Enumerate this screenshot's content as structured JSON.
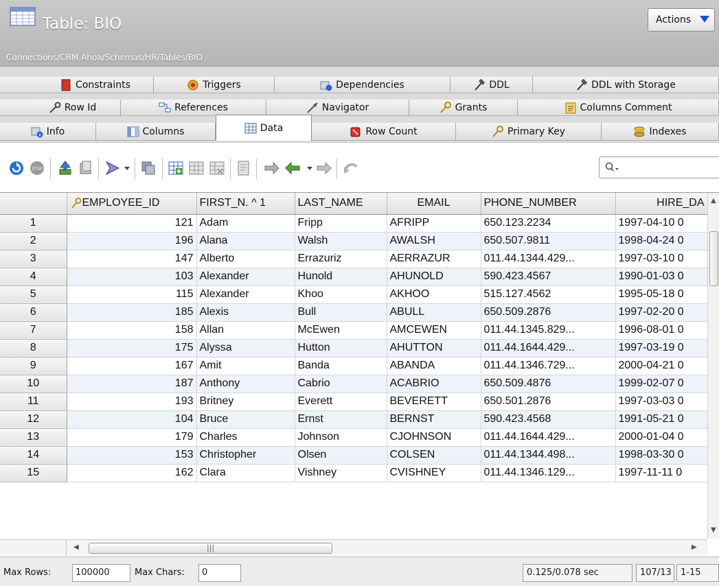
{
  "header": {
    "title": "Table: BIO",
    "path": "Connections/CRM Ahoa/Schemas/HR/Tables/BIO",
    "actions_label": "Actions"
  },
  "tabs": {
    "row1": [
      {
        "label": "Constraints",
        "icon": "constraints-icon"
      },
      {
        "label": "Triggers",
        "icon": "triggers-icon"
      },
      {
        "label": "Dependencies",
        "icon": "dependencies-icon"
      },
      {
        "label": "DDL",
        "icon": "hammer-icon"
      },
      {
        "label": "DDL with Storage",
        "icon": "hammer-icon"
      }
    ],
    "row2": [
      {
        "label": "Row Id",
        "icon": "key-icon"
      },
      {
        "label": "References",
        "icon": "references-icon"
      },
      {
        "label": "Navigator",
        "icon": "navigator-icon"
      },
      {
        "label": "Grants",
        "icon": "key-icon"
      },
      {
        "label": "Columns Comment",
        "icon": "comment-icon"
      }
    ],
    "row3": [
      {
        "label": "Info",
        "icon": "info-icon"
      },
      {
        "label": "Columns",
        "icon": "columns-icon"
      },
      {
        "label": "Data",
        "icon": "grid-icon",
        "selected": true
      },
      {
        "label": "Row Count",
        "icon": "dice-icon"
      },
      {
        "label": "Primary Key",
        "icon": "key-icon"
      },
      {
        "label": "Indexes",
        "icon": "index-icon"
      }
    ]
  },
  "grid": {
    "columns": [
      "",
      "EMPLOYEE_ID",
      "FIRST_N. ^ 1",
      "LAST_NAME",
      "EMAIL",
      "PHONE_NUMBER",
      "HIRE_DA"
    ],
    "rows": [
      [
        "1",
        "121",
        "Adam",
        "Fripp",
        "AFRIPP",
        "650.123.2234",
        "1997-04-10 0"
      ],
      [
        "2",
        "196",
        "Alana",
        "Walsh",
        "AWALSH",
        "650.507.9811",
        "1998-04-24 0"
      ],
      [
        "3",
        "147",
        "Alberto",
        "Errazuriz",
        "AERRAZUR",
        "011.44.1344.429...",
        "1997-03-10 0"
      ],
      [
        "4",
        "103",
        "Alexander",
        "Hunold",
        "AHUNOLD",
        "590.423.4567",
        "1990-01-03 0"
      ],
      [
        "5",
        "115",
        "Alexander",
        "Khoo",
        "AKHOO",
        "515.127.4562",
        "1995-05-18 0"
      ],
      [
        "6",
        "185",
        "Alexis",
        "Bull",
        "ABULL",
        "650.509.2876",
        "1997-02-20 0"
      ],
      [
        "7",
        "158",
        "Allan",
        "McEwen",
        "AMCEWEN",
        "011.44.1345.829...",
        "1996-08-01 0"
      ],
      [
        "8",
        "175",
        "Alyssa",
        "Hutton",
        "AHUTTON",
        "011.44.1644.429...",
        "1997-03-19 0"
      ],
      [
        "9",
        "167",
        "Amit",
        "Banda",
        "ABANDA",
        "011.44.1346.729...",
        "2000-04-21 0"
      ],
      [
        "10",
        "187",
        "Anthony",
        "Cabrio",
        "ACABRIO",
        "650.509.4876",
        "1999-02-07 0"
      ],
      [
        "11",
        "193",
        "Britney",
        "Everett",
        "BEVERETT",
        "650.501.2876",
        "1997-03-03 0"
      ],
      [
        "12",
        "104",
        "Bruce",
        "Ernst",
        "BERNST",
        "590.423.4568",
        "1991-05-21 0"
      ],
      [
        "13",
        "179",
        "Charles",
        "Johnson",
        "CJOHNSON",
        "011.44.1644.429...",
        "2000-01-04 0"
      ],
      [
        "14",
        "153",
        "Christopher",
        "Olsen",
        "COLSEN",
        "011.44.1344.498...",
        "1998-03-30 0"
      ],
      [
        "15",
        "162",
        "Clara",
        "Vishney",
        "CVISHNEY",
        "011.44.1346.129...",
        "1997-11-11 0"
      ]
    ]
  },
  "status": {
    "max_rows_label": "Max Rows:",
    "max_rows_value": "100000",
    "max_chars_label": "Max Chars:",
    "max_chars_value": "0",
    "timing": "0.125/0.078 sec",
    "counts": "107/13",
    "range": "1-15"
  },
  "colors": {
    "header_bg": "#bdbdbd",
    "selected_tab": "#ffffff",
    "alt_row": "#eef3fa",
    "actions_arrow": "#1f4fd1"
  }
}
